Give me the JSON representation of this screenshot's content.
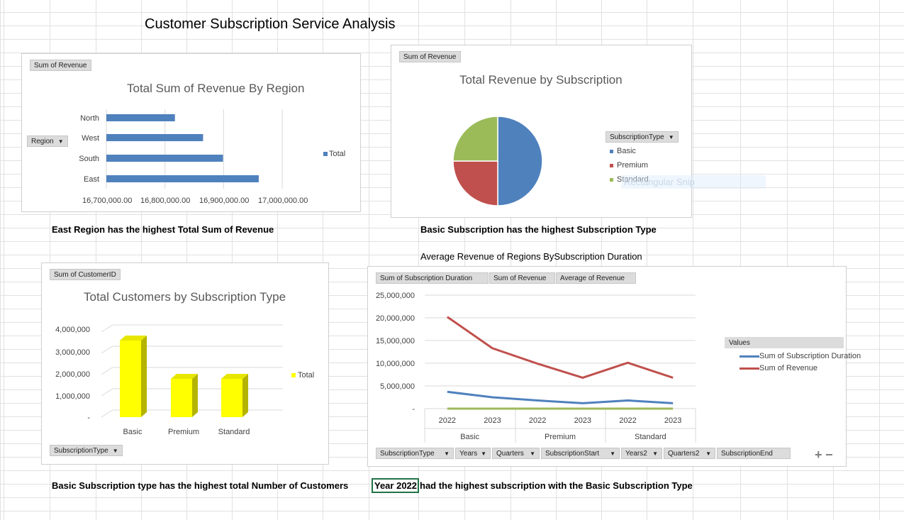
{
  "sheet": {
    "title": "Customer Subscription Service Analysis",
    "captions": {
      "region": "East Region has the highest Total Sum of Revenue",
      "subscription": "Basic Subscription has the highest Subscription Type",
      "duration_heading": "Average Revenue of Regions BySubscription Duration",
      "customers": "Basic Subscription type has the highest total Number of Customers",
      "year_cell": "Year 2022",
      "year_rest": "had the highest subscription with the Basic Subscription Type"
    },
    "snip_overlay": "Rectangular Snip"
  },
  "chart1": {
    "value_button": "Sum of Revenue",
    "axis_button": "Region",
    "legend_label": "Total",
    "legend_color": "#4f81bd"
  },
  "chart2": {
    "value_button": "Sum of Revenue",
    "legend_button": "SubscriptionType",
    "colors": [
      "#4f81bd",
      "#c0504d",
      "#9bbb59"
    ]
  },
  "chart3": {
    "value_button": "Sum of CustomerID",
    "axis_button": "SubscriptionType",
    "legend_label": "Total",
    "bar_color": "#ffff00"
  },
  "chart4": {
    "value_buttons": [
      "Sum of Subscription Duration",
      "Sum of Revenue",
      "Average of Revenue"
    ],
    "legend_title": "Values",
    "axis_buttons": [
      "SubscriptionType",
      "Years",
      "Quarters",
      "SubscriptionStart",
      "Years2",
      "Quarters2",
      "SubscriptionEnd"
    ],
    "axis_buttons_dropdown": [
      true,
      true,
      true,
      true,
      true,
      true,
      false
    ],
    "series_colors": [
      "#4f81bd",
      "#c0504d",
      "#9bbb59"
    ]
  },
  "chart_data": [
    {
      "type": "bar",
      "orientation": "horizontal",
      "title": "Total Sum of Revenue By Region",
      "categories": [
        "North",
        "West",
        "South",
        "East"
      ],
      "series": [
        {
          "name": "Total",
          "values": [
            16817000,
            16865000,
            16899000,
            16960000
          ]
        }
      ],
      "xlim": [
        16700000,
        17000000
      ],
      "xticks": [
        "16,700,000.00",
        "16,800,000.00",
        "16,900,000.00",
        "17,000,000.00"
      ],
      "grid": true,
      "legend": "right"
    },
    {
      "type": "pie",
      "title": "Total Revenue by Subscription",
      "categories": [
        "Basic",
        "Premium",
        "Standard"
      ],
      "values": [
        50,
        25,
        25
      ],
      "legend": "right"
    },
    {
      "type": "bar",
      "title": "Total Customers by Subscription Type",
      "categories": [
        "Basic",
        "Premium",
        "Standard"
      ],
      "series": [
        {
          "name": "Total",
          "values": [
            3600000,
            1800000,
            1800000
          ]
        }
      ],
      "ylim": [
        0,
        4000000
      ],
      "yticks": [
        "-",
        "1,000,000",
        "2,000,000",
        "3,000,000",
        "4,000,000"
      ],
      "legend": "right"
    },
    {
      "type": "line",
      "x": [
        "2022",
        "2023",
        "2022",
        "2023",
        "2022",
        "2023"
      ],
      "groups": [
        "Basic",
        "Premium",
        "Standard"
      ],
      "series": [
        {
          "name": "Sum of Subscription Duration",
          "values": [
            3700000,
            2500000,
            1800000,
            1200000,
            1800000,
            1200000
          ]
        },
        {
          "name": "Sum of Revenue",
          "values": [
            20200000,
            13300000,
            9900000,
            6800000,
            10100000,
            6800000
          ]
        },
        {
          "values": [
            0,
            0,
            0,
            0,
            0,
            0
          ]
        }
      ],
      "ylim": [
        0,
        25000000
      ],
      "yticks": [
        "-",
        "5,000,000",
        "10,000,000",
        "15,000,000",
        "20,000,000",
        "25,000,000"
      ],
      "legend": "right"
    }
  ]
}
